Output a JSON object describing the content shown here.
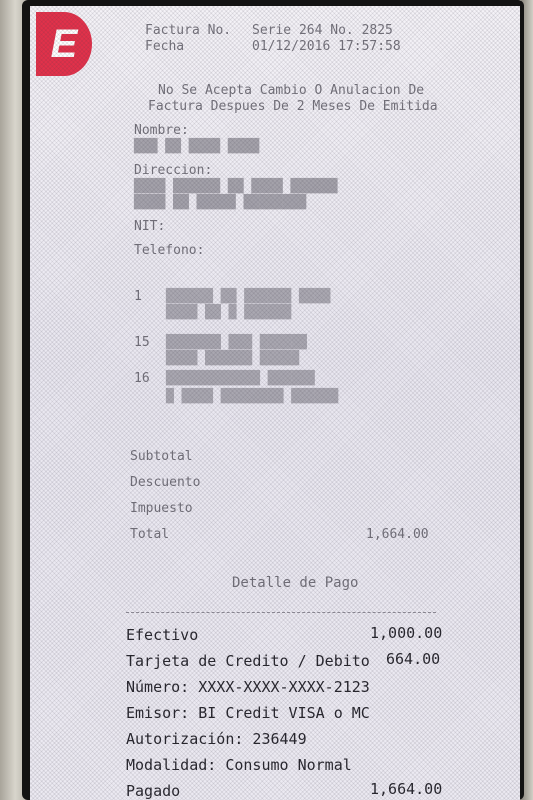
{
  "receipt": {
    "header": {
      "factura_label": "Factura No.",
      "factura_value": "Serie 264 No. 2825",
      "fecha_label": "Fecha",
      "fecha_value": "01/12/2016 17:57:58"
    },
    "notice_1": "No Se Acepta Cambio O Anulacion De",
    "notice_2": "Factura Despues De 2 Meses De Emitida",
    "cliente": {
      "nombre_label": "Nombre:",
      "direccion_label": "Direccion:",
      "nit_label": "NIT:",
      "telefono_label": "Telefono:"
    },
    "items": [
      {
        "qty": "1"
      },
      {
        "qty": "15"
      },
      {
        "qty": "16"
      }
    ],
    "totals": {
      "subtotal_label": "Subtotal",
      "descuento_label": "Descuento",
      "impuesto_label": "Impuesto",
      "total_label": "Total",
      "total_value": "1,664.00"
    },
    "payment": {
      "title": "Detalle de Pago",
      "efectivo_label": "Efectivo",
      "efectivo_value": "1,000.00",
      "tarjeta_label": "Tarjeta de Credito / Debito",
      "tarjeta_value": "664.00",
      "numero": "Número: XXXX-XXXX-XXXX-2123",
      "emisor": "Emisor: BI Credit VISA o MC",
      "autorizacion": "Autorización: 236449",
      "modalidad": "Modalidad: Consumo Normal",
      "pagado_label": "Pagado",
      "pagado_value": "1,664.00"
    }
  }
}
